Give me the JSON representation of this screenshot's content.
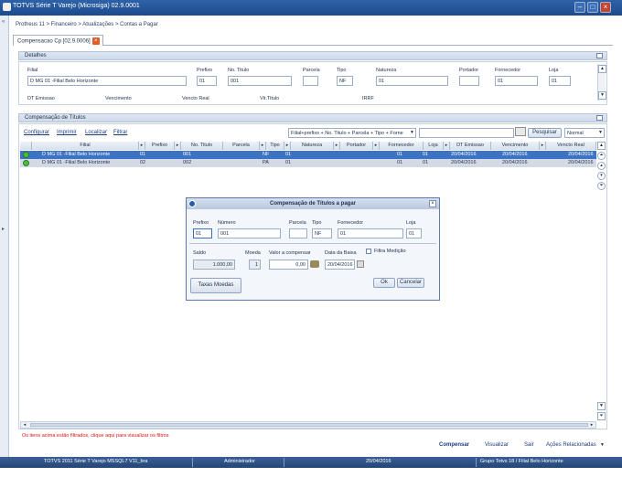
{
  "window": {
    "title": "TOTVS Série T Varejo (Microsiga) 02.9.0001"
  },
  "breadcrumb": "Protheus 11 > Financeiro > Atualizações > Contas a Pagar",
  "tab": {
    "label": "Compensacao Cp [02.9.0006]"
  },
  "detalhes": {
    "title": "Detalhes",
    "filial_label": "Filial",
    "filial_value": "D MG 01 -Filial Belo Horizonte",
    "prefixo_label": "Prefixo",
    "prefixo_value": "01",
    "titulo_label": "No. Titulo",
    "titulo_value": "001",
    "parcela_label": "Parcela",
    "parcela_value": "",
    "tipo_label": "Tipo",
    "tipo_value": "NF",
    "natureza_label": "Natureza",
    "natureza_value": "01",
    "portador_label": "Portador",
    "portador_value": "",
    "fornecedor_label": "Fornecedor",
    "fornecedor_value": "01",
    "loja_label": "Loja",
    "loja_value": "01",
    "row2": [
      "DT Emissao",
      "Vencimento",
      "Vencto Real",
      "Vlr.Titulo",
      "IRRF"
    ]
  },
  "compensacao": {
    "title": "Compensação de Títulos",
    "actions": [
      "Configurar",
      "Imprimir",
      "Localizar",
      "Filtrar"
    ],
    "order_select": "Filial+prefixo + No. Titulo + Parcela + Tipo + Forne",
    "search_value": "",
    "search_button": "Pesquisar",
    "view_select": "Normal",
    "columns": [
      "Filial",
      "Prefixo",
      "No. Titulo",
      "Parcela",
      "Tipo",
      "Natureza",
      "Portador",
      "Fornecedor",
      "Loja",
      "DT Emissao",
      "Vencimento",
      "Vencto Real"
    ],
    "rows": [
      {
        "filial": "D MG 01 -Filial Belo Horizonte",
        "prefixo": "01",
        "titulo": "001",
        "parcela": "",
        "tipo": "NF",
        "natureza": "01",
        "portador": "",
        "fornecedor": "01",
        "loja": "01",
        "emissao": "20/04/2016",
        "vencimento": "20/04/2016",
        "vencto_real": "20/04/2016"
      },
      {
        "filial": "D MG 01 -Filial Belo Horizonte",
        "prefixo": "02",
        "titulo": "002",
        "parcela": "",
        "tipo": "PA",
        "natureza": "01",
        "portador": "",
        "fornecedor": "01",
        "loja": "01",
        "emissao": "20/04/2016",
        "vencimento": "20/04/2016",
        "vencto_real": "20/04/2016"
      }
    ],
    "filter_note": "Os itens acima estão filtrados, clique aqui para visualizar os filtros"
  },
  "dialog": {
    "title": "Compensação de Títulos a pagar",
    "prefixo_label": "Prefixo",
    "prefixo_value": "01",
    "numero_label": "Número",
    "numero_value": "001",
    "parcela_label": "Parcela",
    "parcela_value": "",
    "tipo_label": "Tipo",
    "tipo_value": "NF",
    "fornecedor_label": "Fornecedor",
    "fornecedor_value": "01",
    "loja_label": "Loja",
    "loja_value": "01",
    "saldo_label": "Saldo",
    "saldo_value": "1.000,00",
    "moeda_label": "Moeda",
    "moeda_value": "1",
    "valor_label": "Valor a compensar",
    "valor_value": "0,00",
    "data_label": "Data da Baixa",
    "data_value": "20/04/2016",
    "filtra_label": "Filtra Medição",
    "taxas_button": "Taxas Moedas",
    "ok_button": "Ok",
    "cancel_button": "Cancelar"
  },
  "bottom_actions": {
    "compensar": "Compensar",
    "visualizar": "Visualizar",
    "sair": "Sair",
    "acoes": "Ações Relacionadas"
  },
  "status": {
    "product": "TOTVS 2011 Série T Varejo MSSQL7 V11_bra",
    "user": "Administrador",
    "date": "20/04/2016",
    "group": "Grupo Totvs 18 / Filial Belo Horizonte"
  }
}
